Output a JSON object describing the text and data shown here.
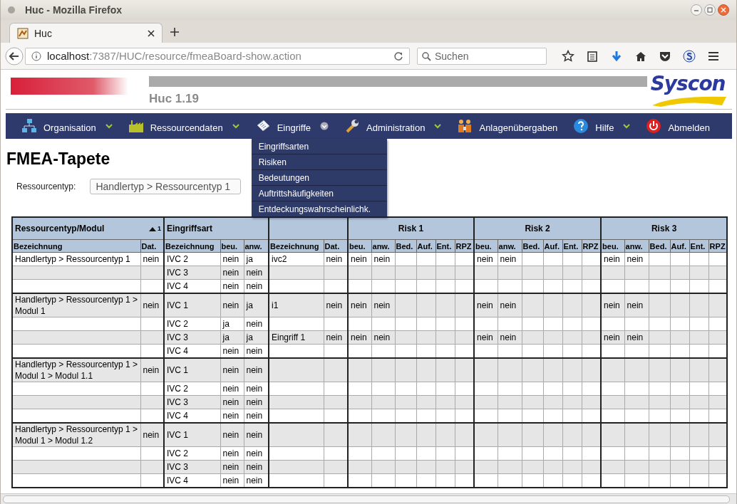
{
  "window": {
    "title": "Huc - Mozilla Firefox"
  },
  "tab": {
    "title": "Huc",
    "selected": true
  },
  "address": {
    "host": "localhost",
    "path": ":7387/HUC/resource/fmeaBoard-show.action"
  },
  "search": {
    "placeholder": "Suchen"
  },
  "header": {
    "version": "Huc 1.19",
    "logo": "Syscon"
  },
  "nav": {
    "items": [
      {
        "label": "Organisation",
        "expanded": false
      },
      {
        "label": "Ressourcendaten",
        "expanded": false
      },
      {
        "label": "Eingriffe",
        "expanded": true
      },
      {
        "label": "Administration",
        "expanded": false
      },
      {
        "label": "Anlagenübergaben"
      },
      {
        "label": "Hilfe",
        "expanded": false
      },
      {
        "label": "Abmelden"
      }
    ],
    "menu": [
      "Eingriffsarten",
      "Risiken",
      "Bedeutungen",
      "Auftrittshäufigkeiten",
      "Entdeckungswahrscheinlichk."
    ]
  },
  "page": {
    "title": "FMEA-Tapete",
    "filter_label": "Ressourcentyp:",
    "filter_value": "Handlertyp > Ressourcentyp 1"
  },
  "table": {
    "sections": [
      {
        "label": "Ressourcentyp/Modul",
        "sort_rank": "1",
        "columns": [
          "Bezeichnung",
          "Dat."
        ]
      },
      {
        "label": "Eingriffsart",
        "columns": [
          "Bezeichnung",
          "beu.",
          "anw."
        ]
      },
      {
        "columns": [
          "Bezeichnung",
          "Dat."
        ]
      },
      {
        "label": "Risk 1",
        "columns": [
          "beu.",
          "anw.",
          "Bed.",
          "Auf.",
          "Ent.",
          "RPZ"
        ]
      },
      {
        "label": "Risk 2",
        "columns": [
          "beu.",
          "anw.",
          "Bed.",
          "Auf.",
          "Ent.",
          "RPZ"
        ]
      },
      {
        "label": "Risk 3",
        "columns": [
          "beu.",
          "anw.",
          "Bed.",
          "Auf.",
          "Ent.",
          "RPZ"
        ]
      }
    ],
    "groups": [
      {
        "resource": "Handlertyp > Ressourcentyp 1",
        "dat": "nein",
        "rows": [
          {
            "art": "IVC 2",
            "beu": "nein",
            "anw": "ja",
            "eingriff": {
              "name": "ivc2",
              "dat": "nein",
              "risks": [
                {
                  "beu": "nein",
                  "anw": "nein"
                },
                {
                  "beu": "nein",
                  "anw": "nein"
                },
                {
                  "beu": "nein",
                  "anw": "nein"
                }
              ]
            }
          },
          {
            "art": "IVC 3",
            "beu": "nein",
            "anw": "nein"
          },
          {
            "art": "IVC 4",
            "beu": "nein",
            "anw": "nein"
          }
        ]
      },
      {
        "resource": "Handlertyp > Ressourcentyp 1 > Modul 1",
        "dat": "nein",
        "rows": [
          {
            "art": "IVC 1",
            "beu": "nein",
            "anw": "ja",
            "eingriff": {
              "name": "i1",
              "dat": "nein",
              "risks": [
                {
                  "beu": "nein",
                  "anw": "nein"
                },
                {
                  "beu": "nein",
                  "anw": "nein"
                },
                {
                  "beu": "nein",
                  "anw": "nein"
                }
              ]
            }
          },
          {
            "art": "IVC 2",
            "beu": "ja",
            "anw": "nein"
          },
          {
            "art": "IVC 3",
            "beu": "ja",
            "anw": "ja",
            "eingriff": {
              "name": "Eingriff 1",
              "dat": "nein",
              "risks": [
                {
                  "beu": "nein",
                  "anw": "nein"
                },
                {
                  "beu": "nein",
                  "anw": "nein"
                },
                {
                  "beu": "nein",
                  "anw": "nein"
                }
              ]
            }
          },
          {
            "art": "IVC 4",
            "beu": "nein",
            "anw": "nein"
          }
        ]
      },
      {
        "resource": "Handlertyp > Ressourcentyp 1 > Modul 1 > Modul 1.1",
        "dat": "nein",
        "rows": [
          {
            "art": "IVC 1",
            "beu": "nein",
            "anw": "nein"
          },
          {
            "art": "IVC 2",
            "beu": "nein",
            "anw": "nein"
          },
          {
            "art": "IVC 3",
            "beu": "nein",
            "anw": "nein"
          },
          {
            "art": "IVC 4",
            "beu": "nein",
            "anw": "nein"
          }
        ]
      },
      {
        "resource": "Handlertyp > Ressourcentyp 1 > Modul 1 > Modul 1.2",
        "dat": "nein",
        "rows": [
          {
            "art": "IVC 1",
            "beu": "nein",
            "anw": "nein"
          },
          {
            "art": "IVC 2",
            "beu": "nein",
            "anw": "nein"
          },
          {
            "art": "IVC 3",
            "beu": "nein",
            "anw": "nein"
          },
          {
            "art": "IVC 4",
            "beu": "nein",
            "anw": "nein"
          }
        ]
      }
    ]
  }
}
